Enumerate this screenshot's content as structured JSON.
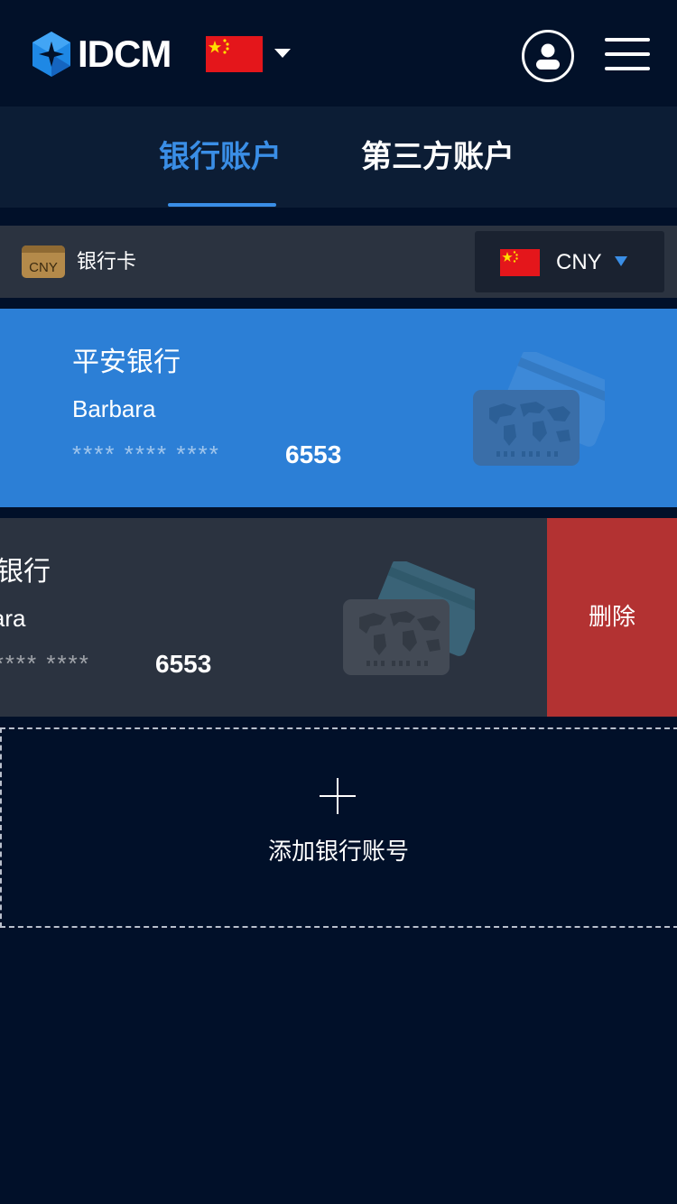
{
  "header": {
    "brand": "IDCM",
    "logo_icon": "idcm-hexagon-logo",
    "region_flag": "china-flag",
    "user_icon": "user-icon",
    "menu_icon": "hamburger-menu-icon"
  },
  "tabs": [
    {
      "label": "银行账户",
      "active": true
    },
    {
      "label": "第三方账户",
      "active": false
    }
  ],
  "filter": {
    "type_icon_text": "CNY",
    "type_label": "银行卡",
    "currency": "CNY"
  },
  "accounts": [
    {
      "bank": "平安银行",
      "holder": "Barbara",
      "masked": "**** **** ****",
      "last4": "6553"
    },
    {
      "bank": "平安银行",
      "holder": "Barbara",
      "masked": "**** **** ****",
      "last4": "6553"
    }
  ],
  "actions": {
    "delete_label": "删除",
    "add_label": "添加银行账号"
  },
  "colors": {
    "accent": "#3a8ee6",
    "background": "#011029",
    "card_active": "#2c7fd6",
    "card_inactive": "#2b3340",
    "delete": "#b33232"
  }
}
